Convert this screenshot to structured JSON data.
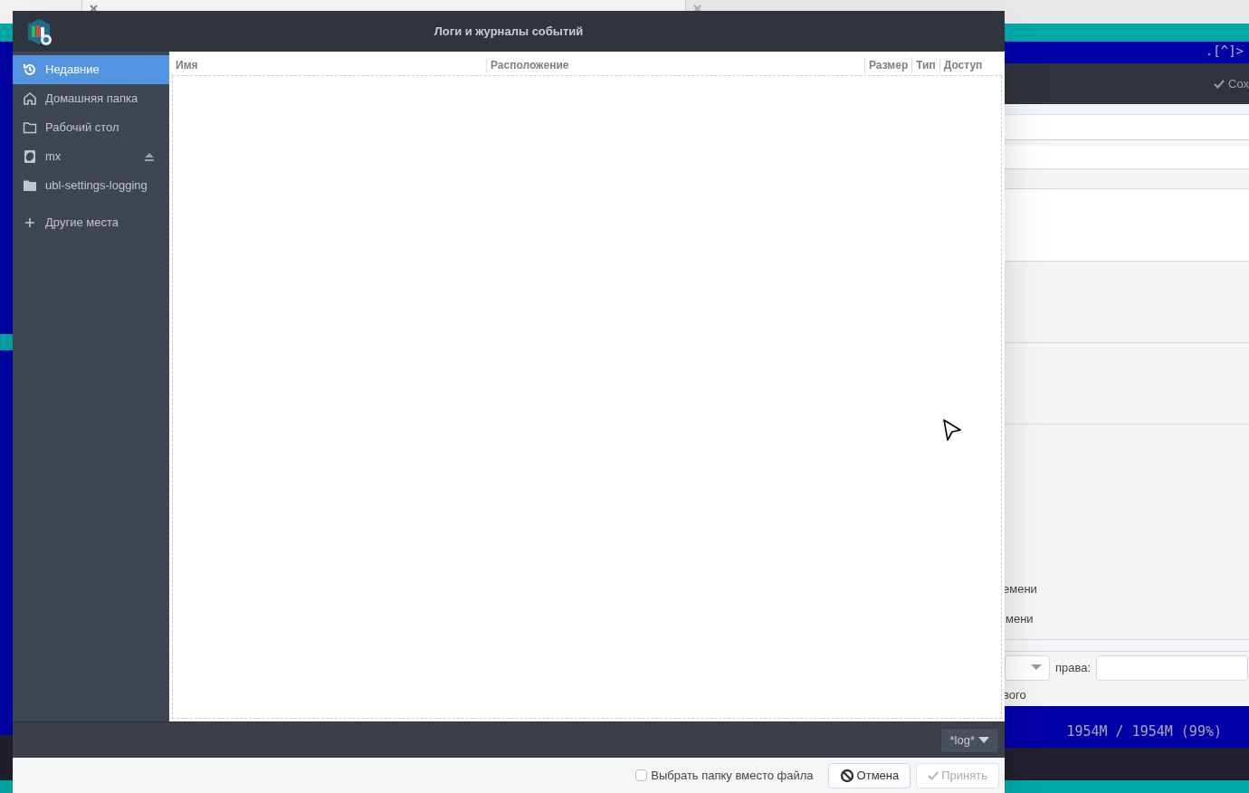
{
  "terminal_tabs": [
    {
      "selected": true
    },
    {
      "selected": false
    }
  ],
  "terminal": {
    "corner": ".[^]>",
    "disk": "1954M / 1954M (99%)"
  },
  "back_window": {
    "save": "Сох",
    "lines": [
      "емени",
      "мени"
    ],
    "rights_label": "права:",
    "footer_fragment": "вого"
  },
  "dialog": {
    "title": "Логи и журналы событий",
    "places": [
      {
        "label": "Недавние",
        "kind": "recent",
        "selected": true,
        "eject": false
      },
      {
        "label": "Домашняя папка",
        "kind": "home",
        "selected": false,
        "eject": false
      },
      {
        "label": "Рабочий стол",
        "kind": "folder",
        "selected": false,
        "eject": false
      },
      {
        "label": "mx",
        "kind": "drive",
        "selected": false,
        "eject": true
      },
      {
        "label": "ubl-settings-logging",
        "kind": "folder-filled",
        "selected": false,
        "eject": false
      },
      {
        "label": "Другие места",
        "kind": "plus",
        "selected": false,
        "eject": false
      }
    ],
    "columns": [
      "Имя",
      "Расположение",
      "Размер",
      "Тип",
      "Доступ"
    ],
    "filter": "*log*",
    "folder_mode": {
      "label": "Выбрать папку вместо файла",
      "checked": false
    },
    "buttons": [
      {
        "label": "Отмена",
        "kind": "cancel",
        "disabled": false
      },
      {
        "label": "Принять",
        "kind": "accept",
        "disabled": true
      }
    ]
  }
}
